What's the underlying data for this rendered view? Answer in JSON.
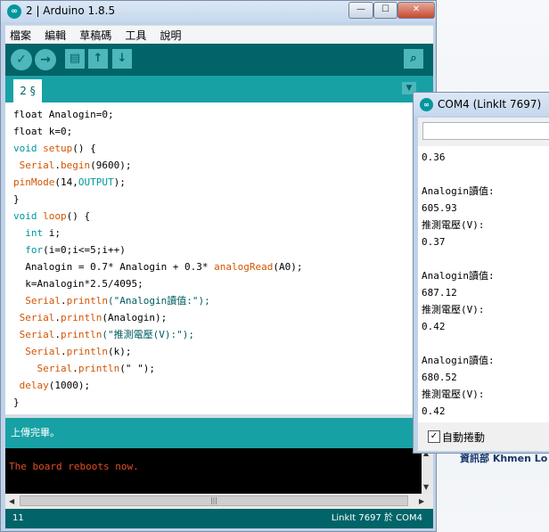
{
  "main_window": {
    "title": "2 | Arduino 1.8.5",
    "app_icon": "infinity-icon",
    "controls": {
      "minimize": "—",
      "maximize": "☐",
      "close": "✕"
    }
  },
  "menu": [
    "檔案",
    "編輯",
    "草稿碼",
    "工具",
    "說明"
  ],
  "toolbar": {
    "verify": "✓",
    "upload": "→",
    "new": "▤",
    "open": "↑",
    "save": "↓",
    "serial_monitor": "⌕"
  },
  "tab": {
    "label": "2 §",
    "menu_arrow": "▼"
  },
  "code": [
    [
      {
        "t": "float Analogin=0;",
        "c": ""
      }
    ],
    [
      {
        "t": "float k=0;",
        "c": ""
      }
    ],
    [
      {
        "t": "void ",
        "c": "kw"
      },
      {
        "t": "setup",
        "c": "fn"
      },
      {
        "t": "() {",
        "c": ""
      }
    ],
    [
      {
        "t": " ",
        "c": ""
      },
      {
        "t": "Serial",
        "c": "fn"
      },
      {
        "t": ".",
        "c": ""
      },
      {
        "t": "begin",
        "c": "fn"
      },
      {
        "t": "(9600);",
        "c": ""
      }
    ],
    [
      {
        "t": "pinMode",
        "c": "fn"
      },
      {
        "t": "(14,",
        "c": ""
      },
      {
        "t": "OUTPUT",
        "c": "kw"
      },
      {
        "t": ");",
        "c": ""
      }
    ],
    [
      {
        "t": "}",
        "c": ""
      }
    ],
    [
      {
        "t": "void ",
        "c": "kw"
      },
      {
        "t": "loop",
        "c": "fn"
      },
      {
        "t": "() {",
        "c": ""
      }
    ],
    [
      {
        "t": "  ",
        "c": ""
      },
      {
        "t": "int",
        "c": "kw"
      },
      {
        "t": " i;",
        "c": ""
      }
    ],
    [
      {
        "t": "  ",
        "c": ""
      },
      {
        "t": "for",
        "c": "kw"
      },
      {
        "t": "(i=0;i<=5;i++)",
        "c": ""
      }
    ],
    [
      {
        "t": "  Analogin = 0.7* Analogin + 0.3* ",
        "c": ""
      },
      {
        "t": "analogRead",
        "c": "fn"
      },
      {
        "t": "(A0);",
        "c": ""
      }
    ],
    [
      {
        "t": "  k=Analogin*2.5/4095;",
        "c": ""
      }
    ],
    [
      {
        "t": "  ",
        "c": ""
      },
      {
        "t": "Serial",
        "c": "fn"
      },
      {
        "t": ".",
        "c": ""
      },
      {
        "t": "println",
        "c": "fn"
      },
      {
        "t": "(\"Analogin讀值:\");",
        "c": "str"
      }
    ],
    [
      {
        "t": " ",
        "c": ""
      },
      {
        "t": "Serial",
        "c": "fn"
      },
      {
        "t": ".",
        "c": ""
      },
      {
        "t": "println",
        "c": "fn"
      },
      {
        "t": "(Analogin);",
        "c": ""
      }
    ],
    [
      {
        "t": " ",
        "c": ""
      },
      {
        "t": "Serial",
        "c": "fn"
      },
      {
        "t": ".",
        "c": ""
      },
      {
        "t": "println",
        "c": "fn"
      },
      {
        "t": "(\"推測電壓(V):\");",
        "c": "str"
      }
    ],
    [
      {
        "t": "  ",
        "c": ""
      },
      {
        "t": "Serial",
        "c": "fn"
      },
      {
        "t": ".",
        "c": ""
      },
      {
        "t": "println",
        "c": "fn"
      },
      {
        "t": "(k);",
        "c": ""
      }
    ],
    [
      {
        "t": "    ",
        "c": ""
      },
      {
        "t": "Serial",
        "c": "fn"
      },
      {
        "t": ".",
        "c": ""
      },
      {
        "t": "println",
        "c": "fn"
      },
      {
        "t": "(\" \");",
        "c": ""
      }
    ],
    [
      {
        "t": " ",
        "c": ""
      },
      {
        "t": "delay",
        "c": "fn"
      },
      {
        "t": "(1000);",
        "c": ""
      }
    ],
    [
      {
        "t": "}",
        "c": ""
      }
    ]
  ],
  "status_message": "上傳完畢。",
  "console": {
    "output": "The board reboots now."
  },
  "footer": {
    "line_number": "11",
    "board_port": "LinkIt 7697 於 COM4"
  },
  "serial_monitor": {
    "title": "COM4 (LinkIt 7697)",
    "input_value": "",
    "output": [
      "0.36",
      "",
      "Analogin讀值:",
      "605.93",
      "推測電壓(V):",
      "0.37",
      "",
      "Analogin讀值:",
      "687.12",
      "推測電壓(V):",
      "0.42",
      "",
      "Analogin讀值:",
      "680.52",
      "推測電壓(V):",
      "0.42"
    ],
    "autoscroll_label": "自動捲動",
    "autoscroll_checked": "✓"
  },
  "desktop_text": "資訊部 Khmen Lo"
}
